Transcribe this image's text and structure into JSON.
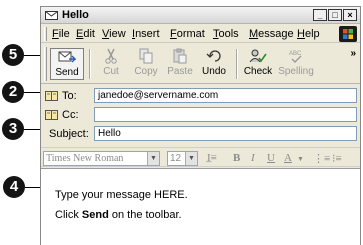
{
  "window": {
    "title": "Hello"
  },
  "menu": [
    {
      "text": "File",
      "u": "F",
      "rest": "ile"
    },
    {
      "text": "Edit",
      "u": "E",
      "rest": "dit"
    },
    {
      "text": "View",
      "u": "V",
      "rest": "iew"
    },
    {
      "text": "Insert",
      "u": "I",
      "rest": "nsert"
    },
    {
      "text": "Format",
      "u": "F",
      "rest": "ormat"
    },
    {
      "text": "Tools",
      "u": "T",
      "rest": "ools"
    },
    {
      "text": "Message",
      "u": "M",
      "rest": "essage"
    },
    {
      "text": "Help",
      "u": "H",
      "rest": "elp"
    }
  ],
  "toolbar": {
    "send": "Send",
    "cut": "Cut",
    "copy": "Copy",
    "paste": "Paste",
    "undo": "Undo",
    "check": "Check",
    "spelling": "Spelling"
  },
  "fields": {
    "to_label": "To:",
    "to_value": "janedoe@servername.com",
    "cc_label": "Cc:",
    "cc_value": "",
    "subject_label": "Subject:",
    "subject_value": "Hello"
  },
  "format": {
    "font": "Times New Roman",
    "size": "12"
  },
  "body": {
    "line1": "Type your message HERE.",
    "line2_pre": "Click ",
    "line2_bold": "Send",
    "line2_post": " on the toolbar."
  },
  "callouts": {
    "send": "5",
    "to": "2",
    "subject": "3",
    "body": "4"
  }
}
